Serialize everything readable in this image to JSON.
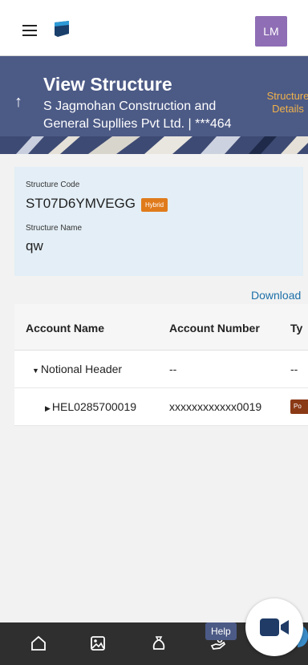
{
  "header": {
    "avatar_initials": "LM"
  },
  "banner": {
    "title": "View Structure",
    "subtitle": "S Jagmohan Construction and General Supllies Pvt Ltd. | ***464",
    "link_line1": "Structure",
    "link_line2": "Details"
  },
  "structure": {
    "code_label": "Structure Code",
    "code_value": "ST07D6YMVEGG",
    "badge": "Hybrid",
    "name_label": "Structure Name",
    "name_value": "qw"
  },
  "download_label": "Download",
  "table": {
    "headers": [
      "Account Name",
      "Account Number",
      "Ty"
    ],
    "rows": [
      {
        "name": "Notional Header",
        "number": "--",
        "type": "--"
      },
      {
        "name": "HEL0285700019",
        "number": "xxxxxxxxxxxx0019",
        "type": "Po"
      }
    ]
  },
  "bottom_nav": {
    "items": [
      "home-icon",
      "image-icon",
      "bag-icon",
      "hand-icon"
    ],
    "help_label": "Help"
  },
  "colors": {
    "banner": "#4c5a86",
    "link_orange": "#f1b24a",
    "hybrid_badge": "#e07b1c",
    "download_blue": "#1d6fa8",
    "card_bg": "#e3eef6"
  }
}
